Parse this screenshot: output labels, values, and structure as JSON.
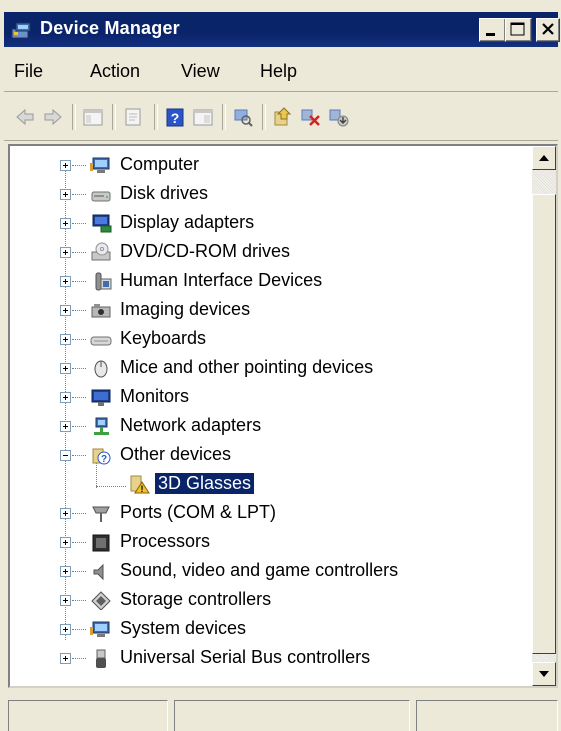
{
  "window": {
    "title": "Device Manager"
  },
  "menu": {
    "file": "File",
    "action": "Action",
    "view": "View",
    "help": "Help"
  },
  "toolbar": {
    "icons": [
      "back-icon",
      "forward-icon",
      "up-icon",
      "properties-icon",
      "help-icon",
      "view-icon",
      "scan-icon",
      "update-driver-icon",
      "uninstall-icon",
      "disable-icon"
    ]
  },
  "tree": {
    "items": [
      {
        "label": "Computer",
        "icon": "computer-icon"
      },
      {
        "label": "Disk drives",
        "icon": "disk-drive-icon"
      },
      {
        "label": "Display adapters",
        "icon": "display-adapter-icon"
      },
      {
        "label": "DVD/CD-ROM drives",
        "icon": "dvd-icon"
      },
      {
        "label": "Human Interface Devices",
        "icon": "hid-icon"
      },
      {
        "label": "Imaging devices",
        "icon": "imaging-icon"
      },
      {
        "label": "Keyboards",
        "icon": "keyboard-icon"
      },
      {
        "label": "Mice and other pointing devices",
        "icon": "mouse-icon"
      },
      {
        "label": "Monitors",
        "icon": "monitor-icon"
      },
      {
        "label": "Network adapters",
        "icon": "network-icon"
      },
      {
        "label": "Other devices",
        "icon": "unknown-device-icon",
        "expanded": true
      },
      {
        "label": "3D Glasses",
        "icon": "warning-device-icon",
        "child": true,
        "selected": true
      },
      {
        "label": "Ports (COM & LPT)",
        "icon": "port-icon"
      },
      {
        "label": "Processors",
        "icon": "processor-icon"
      },
      {
        "label": "Sound, video and game controllers",
        "icon": "sound-icon"
      },
      {
        "label": "Storage controllers",
        "icon": "storage-icon"
      },
      {
        "label": "System devices",
        "icon": "system-icon"
      },
      {
        "label": "Universal Serial Bus controllers",
        "icon": "usb-icon"
      }
    ]
  },
  "colors": {
    "titlebar": "#0a246a",
    "selection": "#0a246a",
    "chrome": "#ece9d8"
  }
}
